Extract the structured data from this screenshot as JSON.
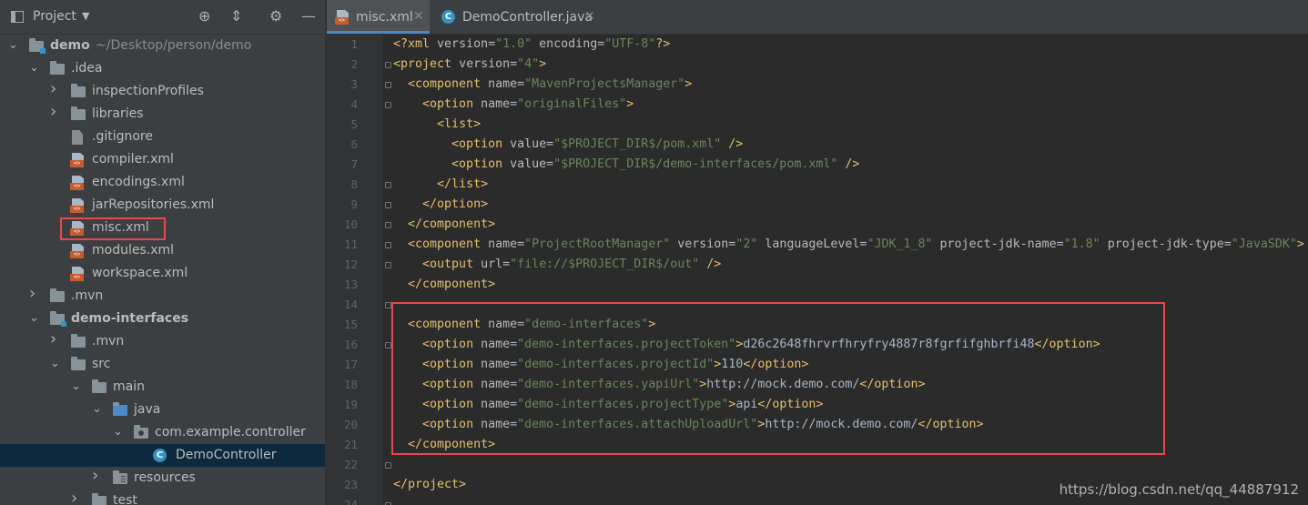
{
  "project_panel": {
    "title": "Project",
    "tree": [
      {
        "label": "demo",
        "hint": "~/Desktop/person/demo",
        "icon": "module-folder-icon",
        "depth": 0,
        "expanded": true,
        "bold": true
      },
      {
        "label": ".idea",
        "icon": "folder-icon",
        "depth": 1,
        "expanded": true
      },
      {
        "label": "inspectionProfiles",
        "icon": "folder-icon",
        "depth": 2,
        "expanded": false
      },
      {
        "label": "libraries",
        "icon": "folder-icon",
        "depth": 2,
        "expanded": false
      },
      {
        "label": ".gitignore",
        "icon": "gitignore-file-icon",
        "depth": 2
      },
      {
        "label": "compiler.xml",
        "icon": "xml-file-icon",
        "depth": 2
      },
      {
        "label": "encodings.xml",
        "icon": "xml-file-icon",
        "depth": 2
      },
      {
        "label": "jarRepositories.xml",
        "icon": "xml-file-icon",
        "depth": 2
      },
      {
        "label": "misc.xml",
        "icon": "xml-file-icon",
        "depth": 2,
        "highlighted": true
      },
      {
        "label": "modules.xml",
        "icon": "xml-file-icon",
        "depth": 2
      },
      {
        "label": "workspace.xml",
        "icon": "xml-file-icon",
        "depth": 2
      },
      {
        "label": ".mvn",
        "icon": "folder-icon",
        "depth": 1,
        "expanded": false
      },
      {
        "label": "demo-interfaces",
        "icon": "module-folder-icon",
        "depth": 1,
        "expanded": true,
        "bold": true
      },
      {
        "label": ".mvn",
        "icon": "folder-icon",
        "depth": 2,
        "expanded": false
      },
      {
        "label": "src",
        "icon": "folder-icon",
        "depth": 2,
        "expanded": true
      },
      {
        "label": "main",
        "icon": "folder-icon",
        "depth": 3,
        "expanded": true
      },
      {
        "label": "java",
        "icon": "source-folder-icon",
        "depth": 4,
        "expanded": true
      },
      {
        "label": "com.example.controller",
        "icon": "package-icon",
        "depth": 5,
        "expanded": true
      },
      {
        "label": "DemoController",
        "icon": "java-class-icon",
        "depth": 6,
        "selected": true
      },
      {
        "label": "resources",
        "icon": "resources-folder-icon",
        "depth": 4,
        "expanded": false
      },
      {
        "label": "test",
        "icon": "folder-icon",
        "depth": 3,
        "expanded": false
      }
    ]
  },
  "editor": {
    "tabs": [
      {
        "label": "misc.xml",
        "icon": "xml-file-icon",
        "active": true
      },
      {
        "label": "DemoController.java",
        "icon": "java-class-icon",
        "active": false
      }
    ],
    "line_numbers": [
      "1",
      "2",
      "3",
      "4",
      "5",
      "6",
      "7",
      "8",
      "9",
      "10",
      "11",
      "12",
      "13",
      "14",
      "15",
      "16",
      "17",
      "18",
      "19",
      "20",
      "21",
      "22",
      "23",
      "24"
    ],
    "lines": [
      [
        [
          "t-tag",
          "<?xml "
        ],
        [
          "t-attr",
          "version"
        ],
        [
          "t-text",
          "="
        ],
        [
          "t-val",
          "\"1.0\""
        ],
        [
          "t-text",
          " "
        ],
        [
          "t-attr",
          "encoding"
        ],
        [
          "t-text",
          "="
        ],
        [
          "t-val",
          "\"UTF-8\""
        ],
        [
          "t-tag",
          "?>"
        ]
      ],
      [
        [
          "t-tag",
          "<project "
        ],
        [
          "t-attr",
          "version"
        ],
        [
          "t-text",
          "="
        ],
        [
          "t-val",
          "\"4\""
        ],
        [
          "t-tag",
          ">"
        ]
      ],
      [
        [
          "t-text",
          "  "
        ],
        [
          "t-tag",
          "<component "
        ],
        [
          "t-attr",
          "name"
        ],
        [
          "t-text",
          "="
        ],
        [
          "t-val",
          "\"MavenProjectsManager\""
        ],
        [
          "t-tag",
          ">"
        ]
      ],
      [
        [
          "t-text",
          "    "
        ],
        [
          "t-tag",
          "<option "
        ],
        [
          "t-attr",
          "name"
        ],
        [
          "t-text",
          "="
        ],
        [
          "t-val",
          "\"originalFiles\""
        ],
        [
          "t-tag",
          ">"
        ]
      ],
      [
        [
          "t-text",
          "      "
        ],
        [
          "t-tag",
          "<list>"
        ]
      ],
      [
        [
          "t-text",
          "        "
        ],
        [
          "t-tag",
          "<option "
        ],
        [
          "t-attr",
          "value"
        ],
        [
          "t-text",
          "="
        ],
        [
          "t-val",
          "\"$PROJECT_DIR$/pom.xml\""
        ],
        [
          "t-text",
          " "
        ],
        [
          "t-tag",
          "/>"
        ]
      ],
      [
        [
          "t-text",
          "        "
        ],
        [
          "t-tag",
          "<option "
        ],
        [
          "t-attr",
          "value"
        ],
        [
          "t-text",
          "="
        ],
        [
          "t-val",
          "\"$PROJECT_DIR$/demo-interfaces/pom.xml\""
        ],
        [
          "t-text",
          " "
        ],
        [
          "t-tag",
          "/>"
        ]
      ],
      [
        [
          "t-text",
          "      "
        ],
        [
          "t-tag",
          "</list>"
        ]
      ],
      [
        [
          "t-text",
          "    "
        ],
        [
          "t-tag",
          "</option>"
        ]
      ],
      [
        [
          "t-text",
          "  "
        ],
        [
          "t-tag",
          "</component>"
        ]
      ],
      [
        [
          "t-text",
          "  "
        ],
        [
          "t-tag",
          "<component "
        ],
        [
          "t-attr",
          "name"
        ],
        [
          "t-text",
          "="
        ],
        [
          "t-val",
          "\"ProjectRootManager\""
        ],
        [
          "t-text",
          " "
        ],
        [
          "t-attr",
          "version"
        ],
        [
          "t-text",
          "="
        ],
        [
          "t-val",
          "\"2\""
        ],
        [
          "t-text",
          " "
        ],
        [
          "t-attr",
          "languageLevel"
        ],
        [
          "t-text",
          "="
        ],
        [
          "t-val",
          "\"JDK_1_8\""
        ],
        [
          "t-text",
          " "
        ],
        [
          "t-attr",
          "project-jdk-name"
        ],
        [
          "t-text",
          "="
        ],
        [
          "t-val",
          "\"1.8\""
        ],
        [
          "t-text",
          " "
        ],
        [
          "t-attr",
          "project-jdk-type"
        ],
        [
          "t-text",
          "="
        ],
        [
          "t-val",
          "\"JavaSDK\""
        ],
        [
          "t-tag",
          ">"
        ]
      ],
      [
        [
          "t-text",
          "    "
        ],
        [
          "t-tag",
          "<output "
        ],
        [
          "t-attr",
          "url"
        ],
        [
          "t-text",
          "="
        ],
        [
          "t-val",
          "\"file://$PROJECT_DIR$/out\""
        ],
        [
          "t-text",
          " "
        ],
        [
          "t-tag",
          "/>"
        ]
      ],
      [
        [
          "t-text",
          "  "
        ],
        [
          "t-tag",
          "</component>"
        ]
      ],
      [],
      [
        [
          "t-text",
          "  "
        ],
        [
          "t-tag",
          "<component "
        ],
        [
          "t-attr",
          "name"
        ],
        [
          "t-text",
          "="
        ],
        [
          "t-val",
          "\"demo-interfaces\""
        ],
        [
          "t-tag",
          ">"
        ]
      ],
      [
        [
          "t-text",
          "    "
        ],
        [
          "t-tag",
          "<option "
        ],
        [
          "t-attr",
          "name"
        ],
        [
          "t-text",
          "="
        ],
        [
          "t-val",
          "\"demo-interfaces.projectToken\""
        ],
        [
          "t-tag",
          ">"
        ],
        [
          "t-text",
          "d26c2648fhrvrfhryfry4887r8fgrfifghbrfi48"
        ],
        [
          "t-tag",
          "</option>"
        ]
      ],
      [
        [
          "t-text",
          "    "
        ],
        [
          "t-tag",
          "<option "
        ],
        [
          "t-attr",
          "name"
        ],
        [
          "t-text",
          "="
        ],
        [
          "t-val",
          "\"demo-interfaces.projectId\""
        ],
        [
          "t-tag",
          ">"
        ],
        [
          "t-text",
          "110"
        ],
        [
          "t-tag",
          "</option>"
        ]
      ],
      [
        [
          "t-text",
          "    "
        ],
        [
          "t-tag",
          "<option "
        ],
        [
          "t-attr",
          "name"
        ],
        [
          "t-text",
          "="
        ],
        [
          "t-val",
          "\"demo-interfaces.yapiUrl\""
        ],
        [
          "t-tag",
          ">"
        ],
        [
          "t-text",
          "http://mock.demo.com/"
        ],
        [
          "t-tag",
          "</option>"
        ]
      ],
      [
        [
          "t-text",
          "    "
        ],
        [
          "t-tag",
          "<option "
        ],
        [
          "t-attr",
          "name"
        ],
        [
          "t-text",
          "="
        ],
        [
          "t-val",
          "\"demo-interfaces.projectType\""
        ],
        [
          "t-tag",
          ">"
        ],
        [
          "t-text",
          "api"
        ],
        [
          "t-tag",
          "</option>"
        ]
      ],
      [
        [
          "t-text",
          "    "
        ],
        [
          "t-tag",
          "<option "
        ],
        [
          "t-attr",
          "name"
        ],
        [
          "t-text",
          "="
        ],
        [
          "t-val",
          "\"demo-interfaces.attachUploadUrl\""
        ],
        [
          "t-tag",
          ">"
        ],
        [
          "t-text",
          "http://mock.demo.com/"
        ],
        [
          "t-tag",
          "</option>"
        ]
      ],
      [
        [
          "t-text",
          "  "
        ],
        [
          "t-tag",
          "</component>"
        ]
      ],
      [],
      [
        [
          "t-tag",
          "</project>"
        ]
      ],
      []
    ]
  },
  "watermark": "https://blog.csdn.net/qq_44887912",
  "colors": {
    "highlight_box": "#e8474d",
    "selected_row": "#0d293e",
    "tag": "#e8bf6a",
    "attr": "#bababa",
    "value": "#6a8759",
    "text": "#a9b7c6"
  }
}
